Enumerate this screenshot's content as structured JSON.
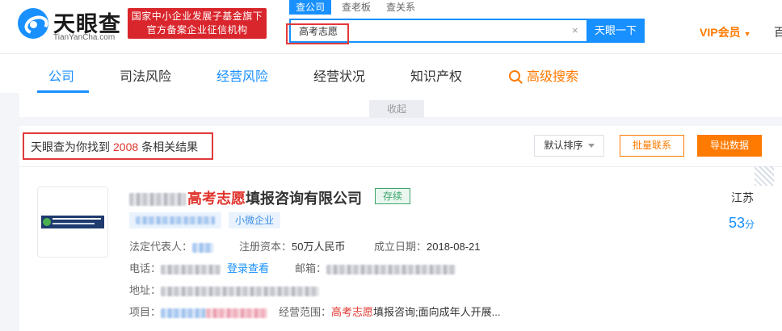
{
  "header": {
    "logo_cn": "天眼查",
    "logo_en": "TianYanCha.com",
    "banner_line1": "国家中小企业发展子基金旗下",
    "banner_line2": "官方备案企业征信机构",
    "search_tabs": [
      "查公司",
      "查老板",
      "查关系"
    ],
    "search_value": "高考志愿",
    "search_button": "天眼一下",
    "clear_glyph": "×",
    "vip_label": "VIP会员",
    "vip_caret": "▼",
    "edge_char": "百"
  },
  "nav": {
    "items": [
      "公司",
      "司法风险",
      "经营风险",
      "经营状况",
      "知识产权",
      "高级搜索"
    ]
  },
  "collapse_label": "收起",
  "results": {
    "found_prefix": "天眼查为你找到",
    "found_count": "2008",
    "found_suffix": "条相关结果",
    "sort_label": "默认排序",
    "batch_label": "批量联系",
    "export_label": "导出数据"
  },
  "company": {
    "name_keyword": "高考志愿",
    "name_suffix": "填报咨询有限公司",
    "status": "存续",
    "tag": "小微企业",
    "legal_rep_label": "法定代表人：",
    "capital_label": "注册资本：",
    "capital_value": "50万人民币",
    "founded_label": "成立日期：",
    "founded_value": "2018-08-21",
    "phone_label": "电话：",
    "phone_link": "登录查看",
    "email_label": "邮箱：",
    "address_label": "地址：",
    "project_label": "项目：",
    "scope_label": "经营范围：",
    "scope_keyword": "高考志愿",
    "scope_rest": "填报咨询;面向成年人开展...",
    "region": "江苏",
    "score": "53",
    "score_unit": "分"
  }
}
